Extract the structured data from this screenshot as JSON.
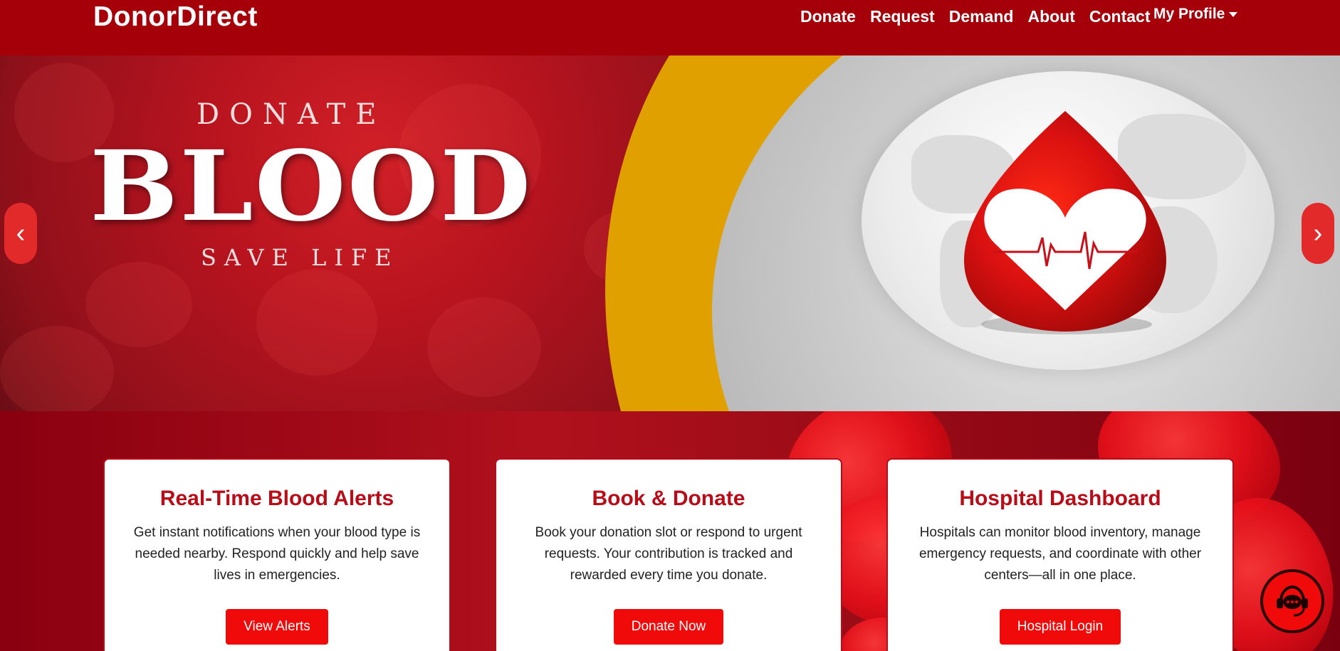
{
  "navbar": {
    "brand": "DonorDirect",
    "links": [
      {
        "label": "Donate"
      },
      {
        "label": "Request"
      },
      {
        "label": "Demand"
      },
      {
        "label": "About"
      },
      {
        "label": "Contact"
      }
    ],
    "profile_label": "My Profile"
  },
  "hero": {
    "line1": "DONATE",
    "line2": "BLOOD",
    "line3": "SAVE LIFE",
    "prev_icon": "‹",
    "next_icon": "›"
  },
  "cards": [
    {
      "title": "Real-Time Blood Alerts",
      "text": "Get instant notifications when your blood type is needed nearby. Respond quickly and help save lives in emergencies.",
      "button": "View Alerts"
    },
    {
      "title": "Book & Donate",
      "text": "Book your donation slot or respond to urgent requests. Your contribution is tracked and rewarded every time you donate.",
      "button": "Donate Now"
    },
    {
      "title": "Hospital Dashboard",
      "text": "Hospitals can monitor blood inventory, manage emergency requests, and coordinate with other centers—all in one place.",
      "button": "Hospital Login"
    }
  ],
  "colors": {
    "navbar": "#a50009",
    "accent": "#b80d18",
    "button": "#f00a0a",
    "gold": "#e0a000"
  },
  "icons": {
    "chat": "support-chat-icon",
    "prev": "chevron-left-icon",
    "next": "chevron-right-icon",
    "caret": "caret-down-icon"
  }
}
